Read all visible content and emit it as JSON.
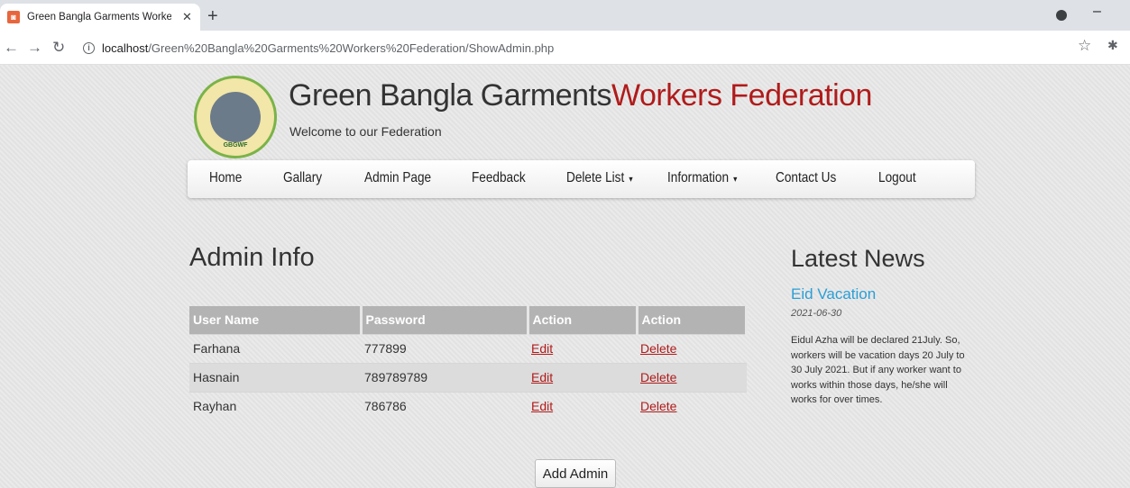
{
  "browser": {
    "tab_title": "Green Bangla Garments Workers",
    "url_host": "localhost",
    "url_path": "/Green%20Bangla%20Garments%20Workers%20Federation/ShowAdmin.php"
  },
  "header": {
    "title_part1": "Green Bangla Garments",
    "title_part2": "Workers Federation",
    "subtitle": "Welcome to our Federation",
    "logo_text": "GBGWF"
  },
  "nav": {
    "items": [
      "Home",
      "Gallary",
      "Admin Page",
      "Feedback",
      "Delete List",
      "Information",
      "Contact Us",
      "Logout"
    ]
  },
  "admin": {
    "heading": "Admin Info",
    "columns": [
      "User Name",
      "Password",
      "Action",
      "Action"
    ],
    "rows": [
      {
        "user": "Farhana",
        "password": "777899",
        "edit": "Edit",
        "delete": "Delete"
      },
      {
        "user": "Hasnain",
        "password": "789789789",
        "edit": "Edit",
        "delete": "Delete"
      },
      {
        "user": "Rayhan",
        "password": "786786",
        "edit": "Edit",
        "delete": "Delete"
      }
    ],
    "add_button": "Add Admin"
  },
  "news": {
    "heading": "Latest News",
    "item_title": "Eid Vacation",
    "item_date": "2021-06-30",
    "item_body": "Eidul Azha will be declared 21July. So, workers will be vacation days 20 July to 30 July 2021. But if any worker want to works within those days, he/she will works for over times."
  },
  "colors": {
    "brand_red": "#b01b1b",
    "news_blue": "#2a9fd6"
  }
}
